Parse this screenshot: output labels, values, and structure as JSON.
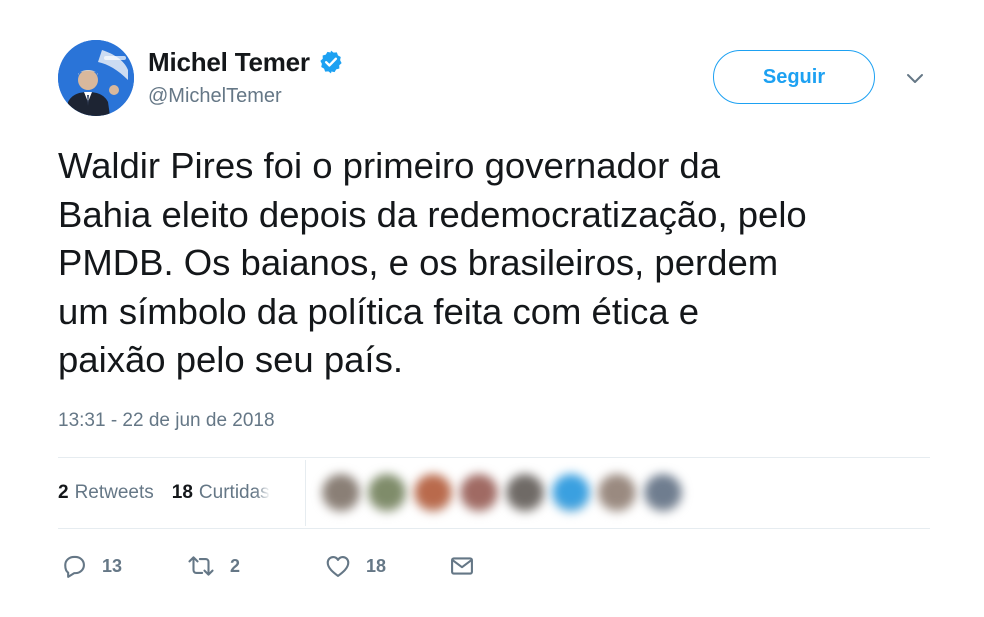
{
  "author": {
    "name": "Michel Temer",
    "handle": "@MichelTemer",
    "verified": true
  },
  "follow_button": {
    "label": "Seguir"
  },
  "tweet": {
    "text": "Waldir Pires foi o primeiro governador da\nBahia eleito depois da redemocratização, pelo\nPMDB. Os baianos, e os brasileiros, perdem\num símbolo da política feita com ética e\npaixão pelo seu país.",
    "timestamp": "13:31 - 22 de jun de 2018"
  },
  "stats": {
    "retweets_count": "2",
    "retweets_label": "Retweets",
    "likes_count": "18",
    "likes_label": "Curtidas"
  },
  "likers": {
    "avatar_colors": [
      "#8a7f76",
      "#7f8c6a",
      "#b96a4c",
      "#a06a63",
      "#6f6a66",
      "#3aa0e0",
      "#9a8a80",
      "#6f7d8f"
    ]
  },
  "actions": {
    "replies": "13",
    "retweets": "2",
    "likes": "18"
  },
  "icons": {
    "verified": "verified-badge-icon",
    "caret": "chevron-down-icon",
    "reply": "reply-icon",
    "retweet": "retweet-icon",
    "like": "heart-icon",
    "message": "direct-message-icon"
  },
  "colors": {
    "accent": "#1da1f2",
    "text": "#14171a",
    "secondary": "#657786",
    "divider": "#e6ecf0"
  }
}
